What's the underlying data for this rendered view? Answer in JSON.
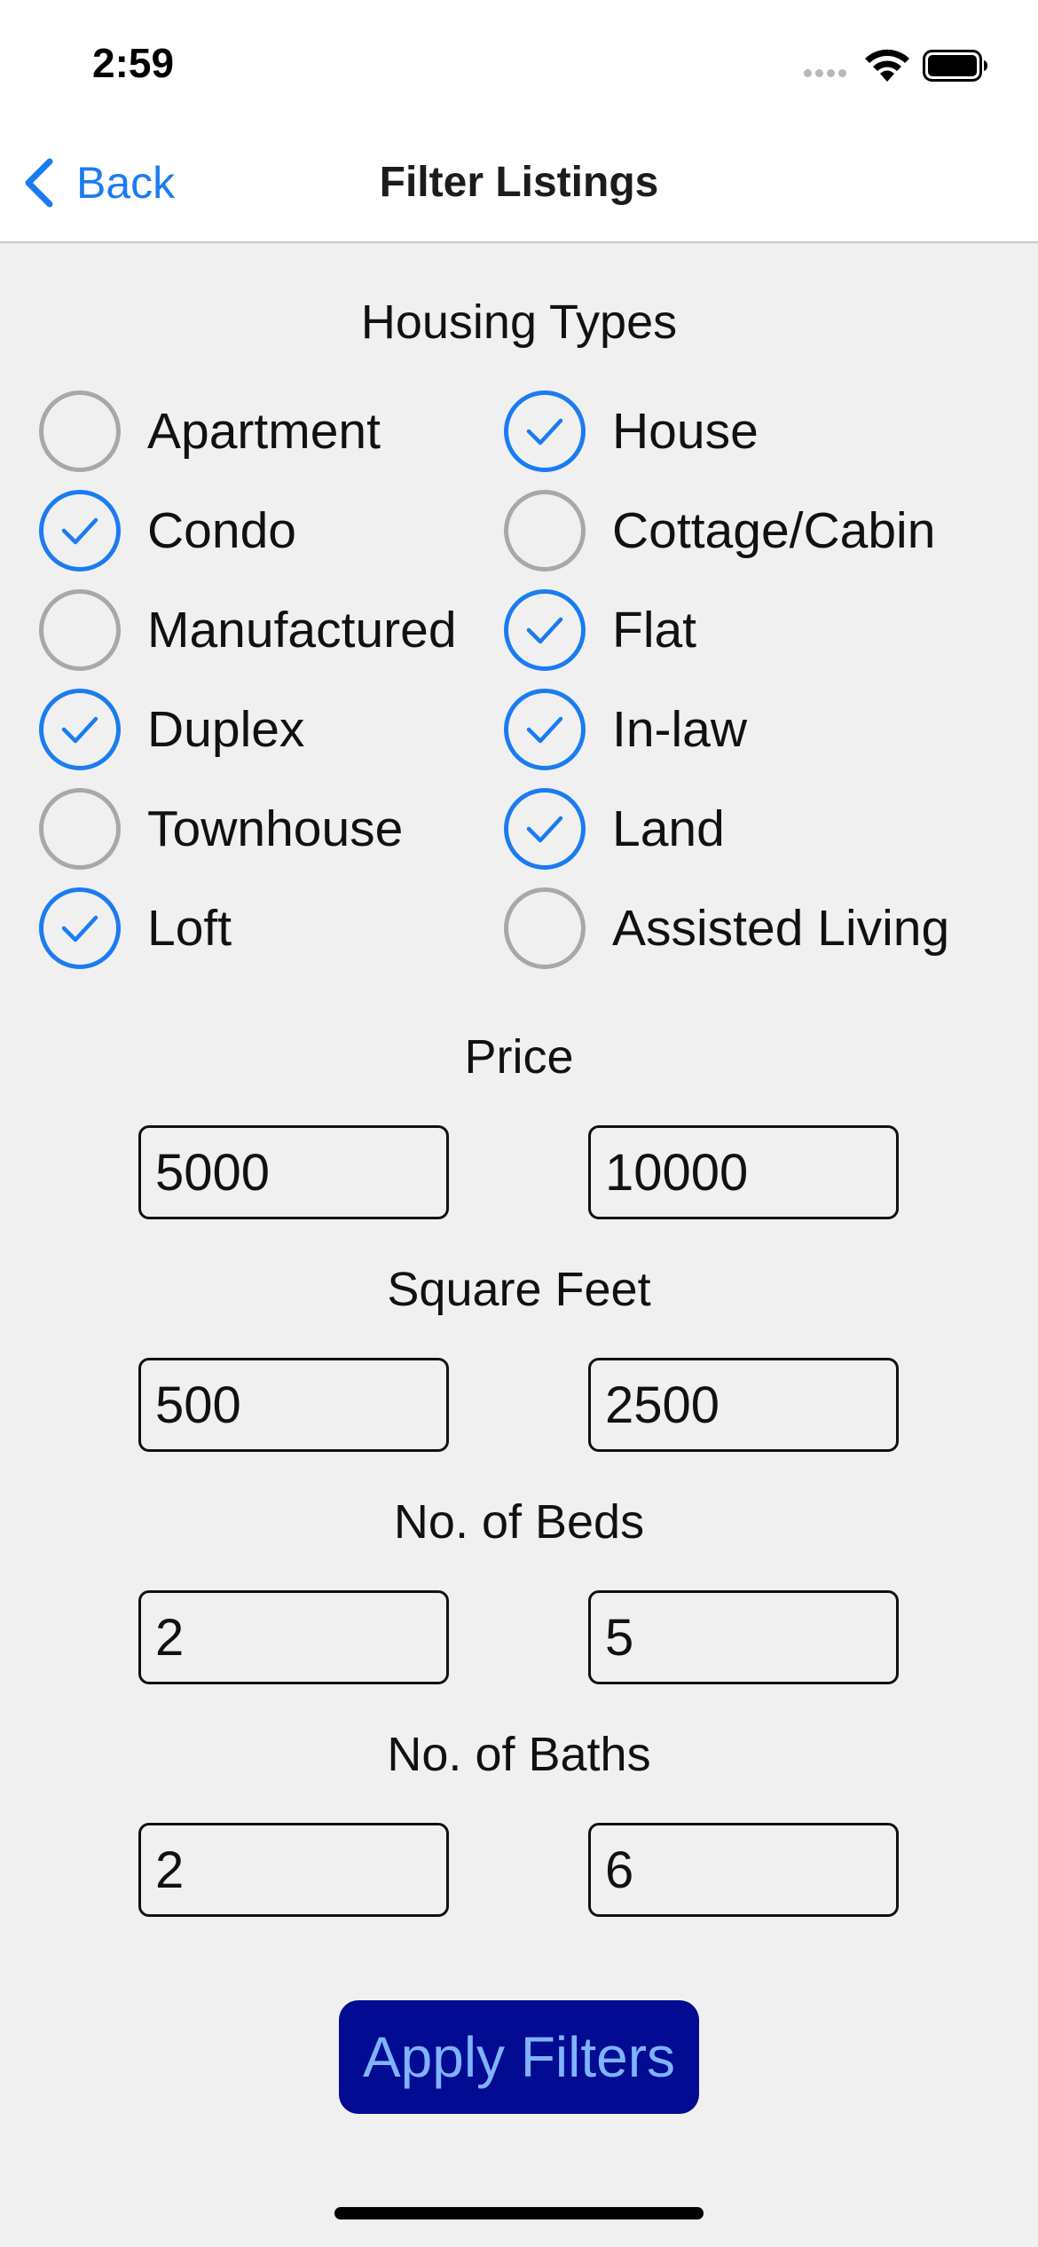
{
  "status_bar": {
    "time": "2:59",
    "icons": [
      "cellular-signal-icon",
      "wifi-icon",
      "battery-icon"
    ]
  },
  "nav": {
    "back_label": "Back",
    "title": "Filter Listings"
  },
  "housing_types": {
    "title": "Housing Types",
    "items": [
      {
        "label": "Apartment",
        "checked": false
      },
      {
        "label": "House",
        "checked": true
      },
      {
        "label": "Condo",
        "checked": true
      },
      {
        "label": "Cottage/Cabin",
        "checked": false
      },
      {
        "label": "Manufactured",
        "checked": false
      },
      {
        "label": "Flat",
        "checked": true
      },
      {
        "label": "Duplex",
        "checked": true
      },
      {
        "label": "In-law",
        "checked": true
      },
      {
        "label": "Townhouse",
        "checked": false
      },
      {
        "label": "Land",
        "checked": true
      },
      {
        "label": "Loft",
        "checked": true
      },
      {
        "label": "Assisted Living",
        "checked": false
      }
    ]
  },
  "ranges": [
    {
      "title": "Price",
      "min": "5000",
      "max": "10000"
    },
    {
      "title": "Square Feet",
      "min": "500",
      "max": "2500"
    },
    {
      "title": "No. of Beds",
      "min": "2",
      "max": "5"
    },
    {
      "title": "No. of Baths",
      "min": "2",
      "max": "6"
    }
  ],
  "apply_label": "Apply Filters",
  "colors": {
    "accent": "#1a7cf0",
    "unchecked": "#a8a8a8",
    "button_bg": "#020b92",
    "button_text": "#7fb2ff",
    "background": "#f0f0f0"
  }
}
